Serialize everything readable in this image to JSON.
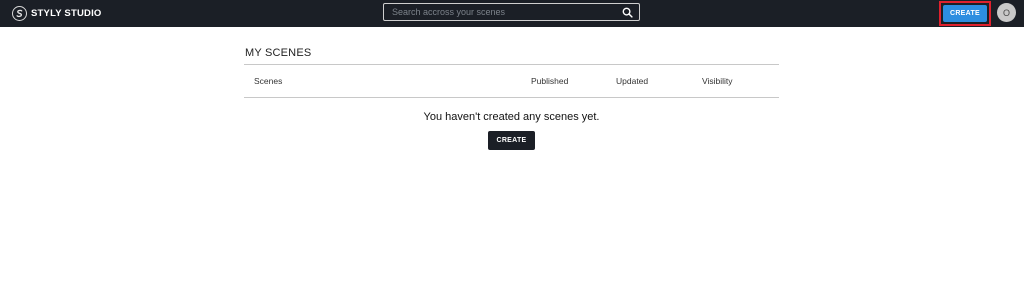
{
  "header": {
    "logo_text": "STYLY STUDIO",
    "search_placeholder": "Search accross your scenes",
    "create_label": "CREATE",
    "avatar_initial": "O"
  },
  "main": {
    "title": "MY SCENES",
    "columns": [
      "Scenes",
      "Published",
      "Updated",
      "Visibility"
    ],
    "empty_message": "You haven't created any scenes yet.",
    "create_label": "CREATE"
  },
  "colors": {
    "topbar_bg": "#1b1f26",
    "accent_blue": "#2d8ee0",
    "highlight_red": "#e0202d"
  }
}
